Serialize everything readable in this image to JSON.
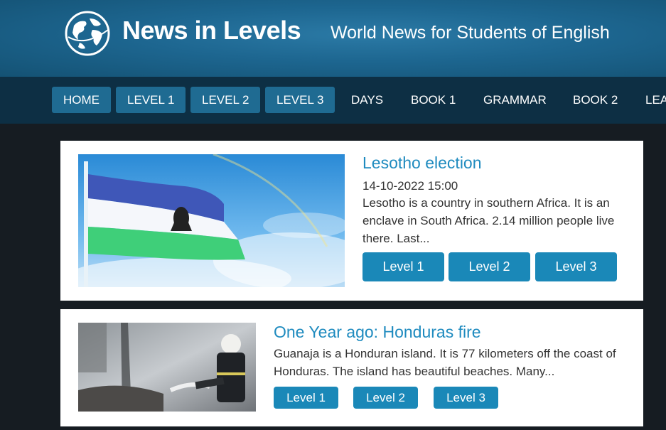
{
  "site": {
    "logo_text": "News in Levels",
    "tagline": "World News for Students of English"
  },
  "nav": {
    "items": [
      {
        "label": "HOME"
      },
      {
        "label": "LEVEL 1"
      },
      {
        "label": "LEVEL 2"
      },
      {
        "label": "LEVEL 3"
      },
      {
        "label": "DAYS"
      },
      {
        "label": "BOOK 1"
      },
      {
        "label": "GRAMMAR"
      },
      {
        "label": "BOOK 2"
      },
      {
        "label": "LEA"
      }
    ]
  },
  "articles": [
    {
      "title": "Lesotho election",
      "date": "14-10-2022 15:00",
      "excerpt": "Lesotho is a country in southern Africa. It is an enclave in South Africa. 2.14 million people live there. Last...",
      "levels": [
        "Level 1",
        "Level 2",
        "Level 3"
      ]
    },
    {
      "title": "One Year ago: Honduras fire",
      "excerpt": "Guanaja is a Honduran island. It is 77 kilometers off the coast of Honduras. The island has beautiful beaches. Many...",
      "levels": [
        "Level 1",
        "Level 2",
        "Level 3"
      ]
    }
  ],
  "colors": {
    "accent": "#1f8bbf",
    "button": "#1a88b8",
    "header": "#1d6690",
    "nav": "#0d2f44"
  }
}
